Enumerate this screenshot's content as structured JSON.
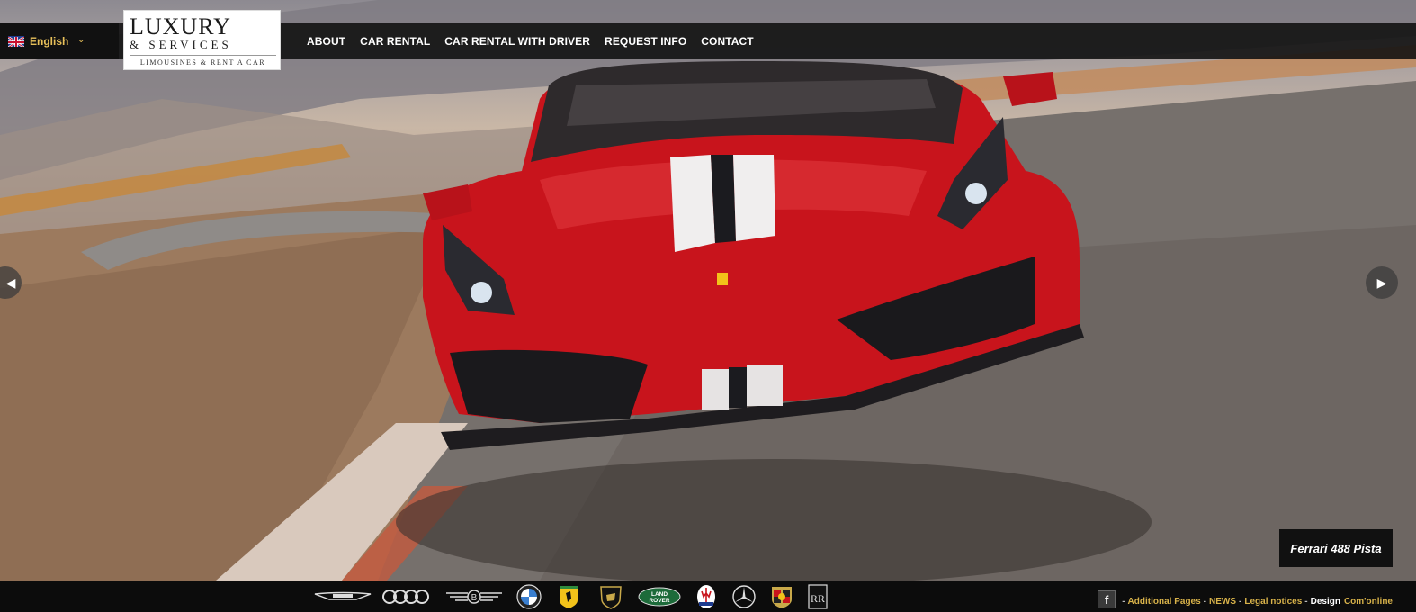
{
  "language": {
    "selected": "English",
    "flag_icon": "uk-flag-icon"
  },
  "logo": {
    "main": "LUXURY",
    "sub1": "& SERVICES",
    "sub2": "LIMOUSINES & RENT A CAR"
  },
  "nav": {
    "items": [
      "ABOUT",
      "CAR RENTAL",
      "CAR RENTAL WITH DRIVER",
      "REQUEST INFO",
      "CONTACT"
    ]
  },
  "slider": {
    "caption": "Ferrari 488 Pista",
    "prev_icon": "chevron-left-icon",
    "next_icon": "chevron-right-icon"
  },
  "brands": [
    "Aston Martin",
    "Audi",
    "Bentley",
    "BMW",
    "Ferrari",
    "Lamborghini",
    "Land Rover",
    "Maserati",
    "Mercedes",
    "Porsche",
    "Rolls-Royce"
  ],
  "footer": {
    "facebook_icon": "facebook-icon",
    "sep": "-",
    "additional_pages": "Additional Pages",
    "news": "NEWS",
    "legal": "Legal notices",
    "design_label": "Design",
    "design_by": "Com'online"
  },
  "colors": {
    "accent_gold": "#d8b24a",
    "car_red": "#c8141c",
    "bar_dark": "#111111"
  }
}
